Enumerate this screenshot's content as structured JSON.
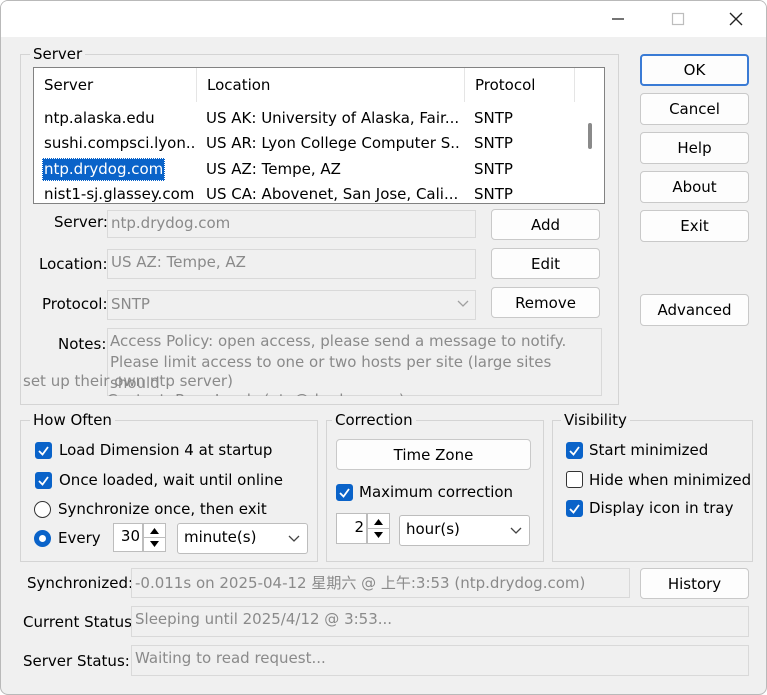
{
  "window": {
    "controls": {
      "minimize": "—",
      "maximize": "☐",
      "close": "✕"
    }
  },
  "server_group": {
    "title": "Server",
    "list": {
      "columns": [
        "Server",
        "Location",
        "Protocol"
      ],
      "rows": [
        {
          "server": "ntp.alaska.edu",
          "location": "US AK: University of Alaska, Fair...",
          "protocol": "SNTP"
        },
        {
          "server": "sushi.compsci.lyon...",
          "location": "US AR: Lyon College Computer S...",
          "protocol": "SNTP"
        },
        {
          "server": "ntp.drydog.com",
          "location": "US AZ: Tempe, AZ",
          "protocol": "SNTP"
        },
        {
          "server": "nist1-sj.glassey.com",
          "location": "US CA: Abovenet, San Jose, Cali...",
          "protocol": "SNTP"
        }
      ]
    },
    "server_label": "Server:",
    "server_value": "ntp.drydog.com",
    "location_label": "Location:",
    "location_value": "US AZ: Tempe, AZ",
    "protocol_label": "Protocol:",
    "protocol_value": "SNTP",
    "notes_label": "Notes:",
    "notes_lines": [
      "Access Policy: open access, please send a message to notify.",
      "Please limit access to one or two hosts per site (large sites should",
      "set up their own ntp server)",
      "Contact: Russ Leeds (ntp@drydog.com)"
    ],
    "add_label": "Add",
    "edit_label": "Edit",
    "remove_label": "Remove"
  },
  "right_buttons": {
    "ok": "OK",
    "cancel": "Cancel",
    "help": "Help",
    "about": "About",
    "exit": "Exit",
    "advanced": "Advanced",
    "history": "History"
  },
  "how_often": {
    "title": "How Often",
    "load_startup": "Load Dimension 4 at startup",
    "wait_online": "Once loaded, wait until online",
    "sync_once": "Synchronize once, then exit",
    "every_label": "Every",
    "every_value": "30",
    "every_unit": "minute(s)",
    "load_startup_checked": true,
    "wait_online_checked": true,
    "selected_mode": "every"
  },
  "correction": {
    "title": "Correction",
    "time_zone": "Time Zone",
    "max_correction": "Maximum correction",
    "max_correction_checked": true,
    "max_value": "2",
    "max_unit": "hour(s)"
  },
  "visibility": {
    "title": "Visibility",
    "start_minimized": "Start minimized",
    "hide_minimized": "Hide when minimized",
    "display_tray": "Display icon in tray",
    "start_minimized_checked": true,
    "hide_minimized_checked": false,
    "display_tray_checked": true
  },
  "status": {
    "synchronized_label": "Synchronized:",
    "synchronized_value": "-0.011s on 2025-04-12 星期六 @ 上午:3:53 (ntp.drydog.com)",
    "current_label": "Current Status:",
    "current_value": "Sleeping until 2025/4/12 @ 3:53...",
    "server_label": "Server Status:",
    "server_value": "Waiting to read request..."
  },
  "colors": {
    "accent": "#0a63c9",
    "window_bg": "#f0f0f0",
    "disabled_text": "#8a8a8a"
  }
}
